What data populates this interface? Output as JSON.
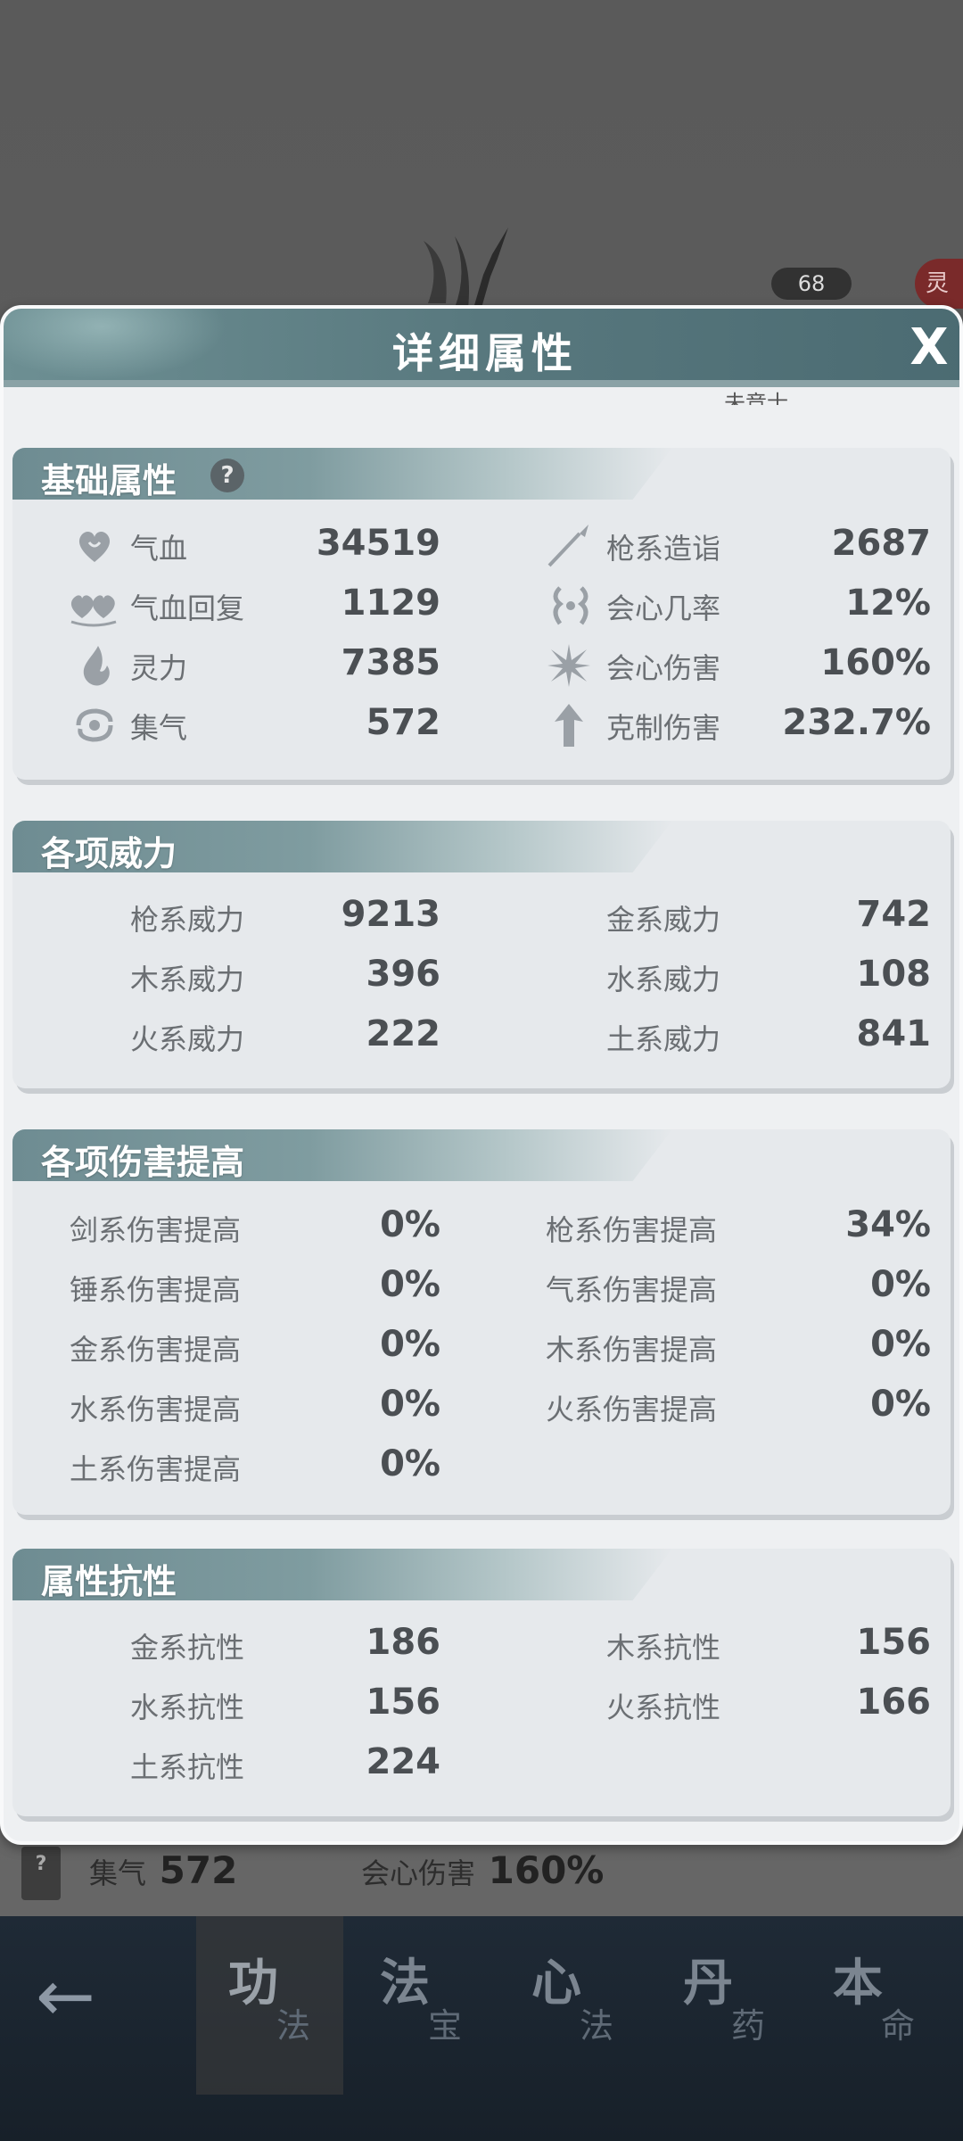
{
  "background": {
    "level": "68",
    "red_tag": "灵",
    "stat1_label": "集气",
    "stat1_value": "572",
    "stat2_label": "会心伤害",
    "stat2_value": "160%",
    "help_mark": "?"
  },
  "bottom_nav": {
    "back": "←",
    "tabs": [
      {
        "big": "功",
        "small": "法"
      },
      {
        "big": "法",
        "small": "宝"
      },
      {
        "big": "心",
        "small": "法"
      },
      {
        "big": "丹",
        "small": "药"
      },
      {
        "big": "本",
        "small": "命"
      }
    ]
  },
  "modal": {
    "title": "详细属性",
    "close": "X",
    "cutoff_text": "未竞士"
  },
  "basic": {
    "title": "基础属性",
    "help": "?",
    "left": [
      {
        "label": "气血",
        "value": "34519",
        "icon": "heart-icon"
      },
      {
        "label": "气血回复",
        "value": "1129",
        "icon": "double-heart-icon"
      },
      {
        "label": "灵力",
        "value": "7385",
        "icon": "flame-drop-icon"
      },
      {
        "label": "集气",
        "value": "572",
        "icon": "swirl-icon"
      }
    ],
    "right": [
      {
        "label": "枪系造诣",
        "value": "2687",
        "icon": "spear-icon"
      },
      {
        "label": "会心几率",
        "value": "12%",
        "icon": "crit-rate-icon"
      },
      {
        "label": "会心伤害",
        "value": "160%",
        "icon": "burst-icon"
      },
      {
        "label": "克制伤害",
        "value": "232.7%",
        "icon": "arrow-up-icon"
      }
    ]
  },
  "power": {
    "title": "各项威力",
    "left": [
      {
        "label": "枪系威力",
        "value": "9213"
      },
      {
        "label": "木系威力",
        "value": "396"
      },
      {
        "label": "火系威力",
        "value": "222"
      }
    ],
    "right": [
      {
        "label": "金系威力",
        "value": "742"
      },
      {
        "label": "水系威力",
        "value": "108"
      },
      {
        "label": "土系威力",
        "value": "841"
      }
    ]
  },
  "damage": {
    "title": "各项伤害提高",
    "left": [
      {
        "label": "剑系伤害提高",
        "value": "0%"
      },
      {
        "label": "锤系伤害提高",
        "value": "0%"
      },
      {
        "label": "金系伤害提高",
        "value": "0%"
      },
      {
        "label": "水系伤害提高",
        "value": "0%"
      },
      {
        "label": "土系伤害提高",
        "value": "0%"
      }
    ],
    "right": [
      {
        "label": "枪系伤害提高",
        "value": "34%"
      },
      {
        "label": "气系伤害提高",
        "value": "0%"
      },
      {
        "label": "木系伤害提高",
        "value": "0%"
      },
      {
        "label": "火系伤害提高",
        "value": "0%"
      }
    ]
  },
  "resist": {
    "title": "属性抗性",
    "left": [
      {
        "label": "金系抗性",
        "value": "186"
      },
      {
        "label": "水系抗性",
        "value": "156"
      },
      {
        "label": "土系抗性",
        "value": "224"
      }
    ],
    "right": [
      {
        "label": "木系抗性",
        "value": "156"
      },
      {
        "label": "火系抗性",
        "value": "166"
      }
    ]
  }
}
